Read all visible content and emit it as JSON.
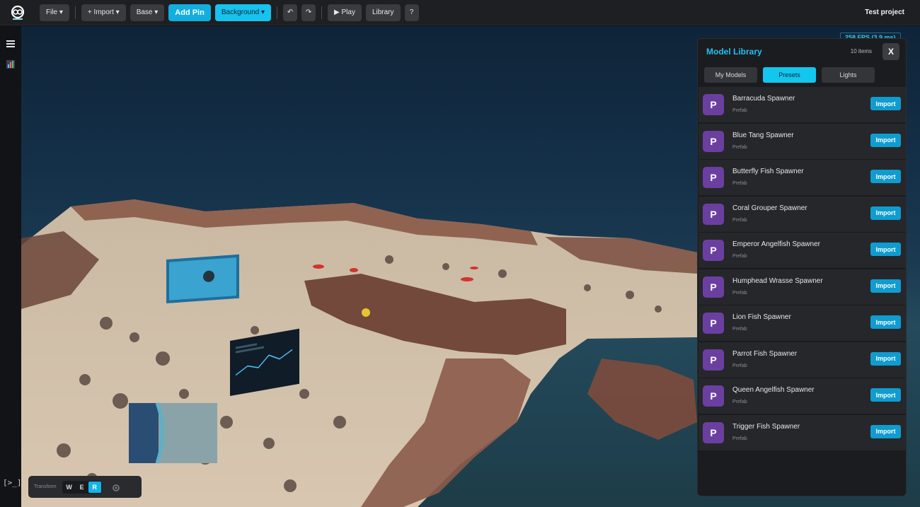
{
  "toolbar": {
    "file": "File ▾",
    "import": "+ Import ▾",
    "base": "Base ▾",
    "add_pin": "Add Pin",
    "background": "Background ▾",
    "undo_icon": "↶",
    "redo_icon": "↷",
    "play": "▶ Play",
    "library": "Library",
    "help": "?",
    "project": "Test project"
  },
  "viewport": {
    "fps": "258 FPS  (3.9 ms)"
  },
  "library": {
    "title": "Model Library",
    "count": "10 items",
    "close": "X",
    "tabs": [
      "My Models",
      "Presets",
      "Lights"
    ],
    "items": [
      {
        "name": "Barracuda Spawner",
        "type": "Prefab",
        "badge": "P",
        "action": "Import"
      },
      {
        "name": "Blue Tang Spawner",
        "type": "Prefab",
        "badge": "P",
        "action": "Import"
      },
      {
        "name": "Butterfly Fish Spawner",
        "type": "Prefab",
        "badge": "P",
        "action": "Import"
      },
      {
        "name": "Coral Grouper Spawner",
        "type": "Prefab",
        "badge": "P",
        "action": "Import"
      },
      {
        "name": "Emperor Angelfish Spawner",
        "type": "Prefab",
        "badge": "P",
        "action": "Import"
      },
      {
        "name": "Humphead Wrasse Spawner",
        "type": "Prefab",
        "badge": "P",
        "action": "Import"
      },
      {
        "name": "Lion Fish Spawner",
        "type": "Prefab",
        "badge": "P",
        "action": "Import"
      },
      {
        "name": "Parrot Fish Spawner",
        "type": "Prefab",
        "badge": "P",
        "action": "Import"
      },
      {
        "name": "Queen Angelfish Spawner",
        "type": "Prefab",
        "badge": "P",
        "action": "Import"
      },
      {
        "name": "Trigger Fish Spawner",
        "type": "Prefab",
        "badge": "P",
        "action": "Import"
      }
    ]
  },
  "transform": {
    "label": "Transform",
    "keys": [
      "W",
      "E",
      "R"
    ]
  },
  "console_label": "[>_]",
  "colors": {
    "accent": "#13c6ee",
    "badge": "#6b3fa0",
    "import": "#0f9cd0"
  }
}
